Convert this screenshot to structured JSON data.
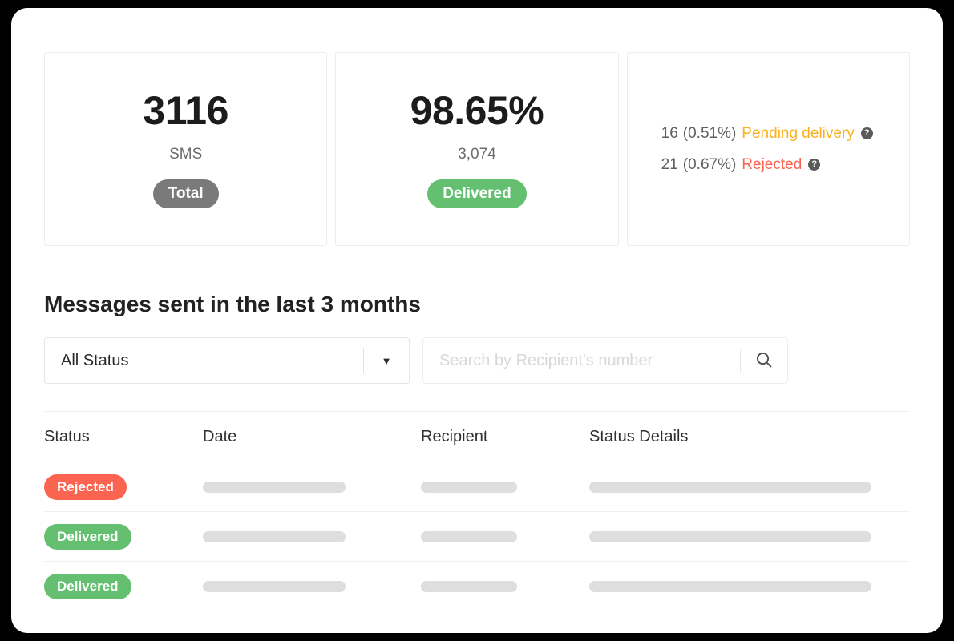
{
  "cards": {
    "total": {
      "figure": "3116",
      "sublabel": "SMS",
      "pill": "Total",
      "pill_color": "#7a7a7a"
    },
    "delivered": {
      "figure": "98.65%",
      "sublabel": "3,074",
      "pill": "Delivered",
      "pill_color": "#64c070"
    },
    "issues": [
      {
        "count": "16",
        "percent": "(0.51%)",
        "label": "Pending delivery",
        "color": "#fbb01e",
        "help": "?"
      },
      {
        "count": "21",
        "percent": "(0.67%)",
        "label": "Rejected",
        "color": "#fa6450",
        "help": "?"
      }
    ]
  },
  "section": {
    "title": "Messages sent in the last 3 months"
  },
  "filters": {
    "status_select": {
      "value": "All Status",
      "caret": "▼"
    },
    "search": {
      "value": "",
      "placeholder": "Search by Recipient's number",
      "icon": "search-icon"
    }
  },
  "table": {
    "columns": [
      "Status",
      "Date",
      "Recipient",
      "Status Details"
    ],
    "rows": [
      {
        "status": "Rejected",
        "status_color": "#fa6450",
        "date": "",
        "recipient": "",
        "details": ""
      },
      {
        "status": "Delivered",
        "status_color": "#64c070",
        "date": "",
        "recipient": "",
        "details": ""
      },
      {
        "status": "Delivered",
        "status_color": "#64c070",
        "date": "",
        "recipient": "",
        "details": ""
      }
    ]
  }
}
